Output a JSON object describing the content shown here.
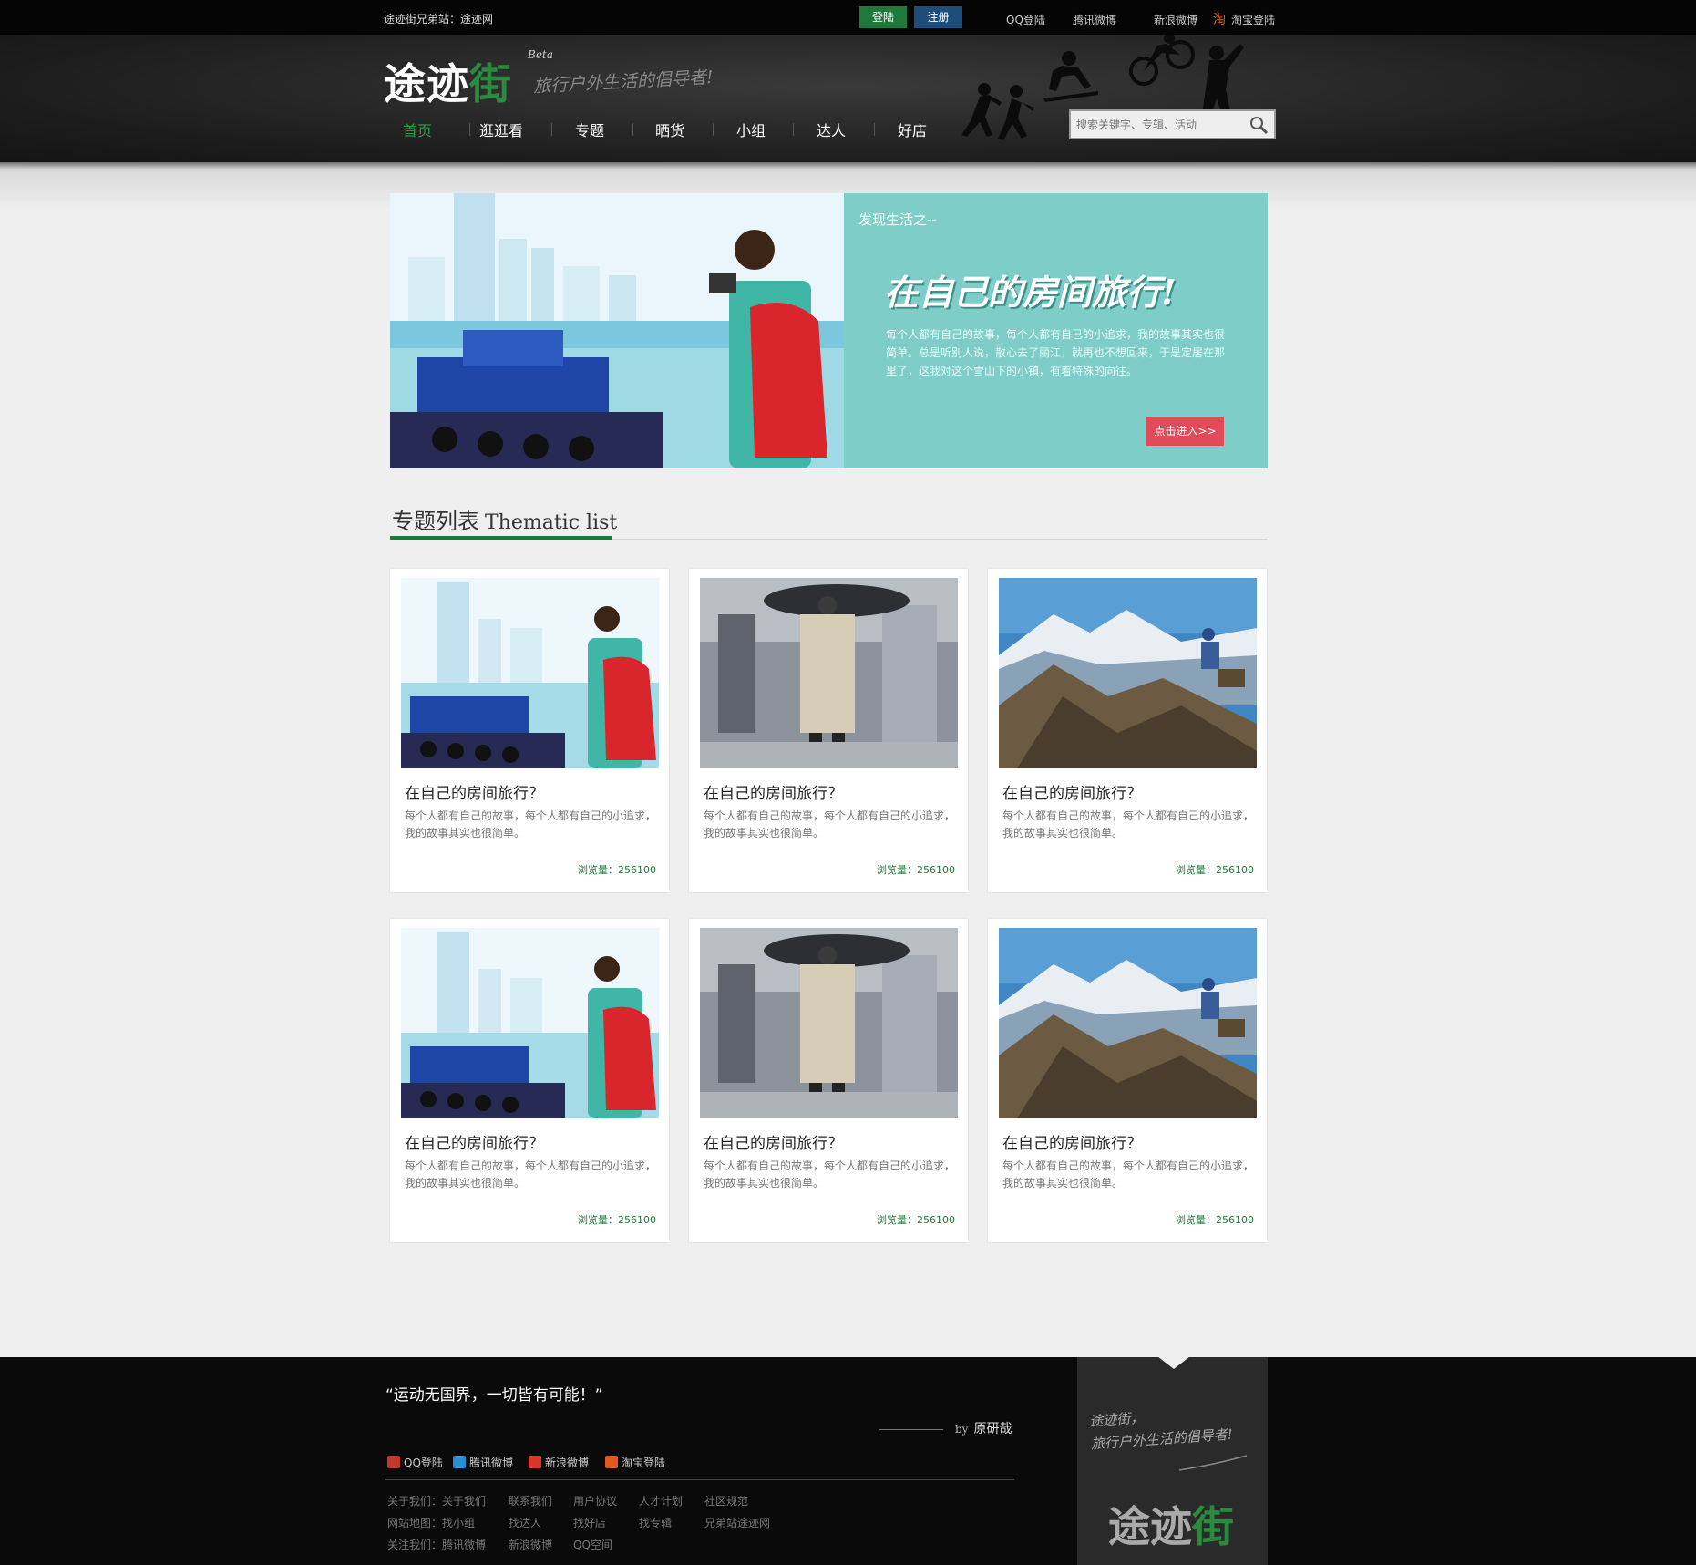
{
  "topbar": {
    "sister_site": "途迹街兄弟站：途迹网",
    "login": "登陆",
    "register": "注册",
    "links": [
      "QQ登陆",
      "腾讯微博",
      "新浪微博",
      "淘宝登陆"
    ]
  },
  "header": {
    "logo_main": "途迹",
    "logo_accent": "街",
    "beta": "Beta",
    "slogan": "旅行户外生活的倡导者!",
    "nav": [
      "首页",
      "逛逛看",
      "专题",
      "晒货",
      "小组",
      "达人",
      "好店"
    ],
    "search_placeholder": "搜索关键字、专辑、活动"
  },
  "banner": {
    "kicker": "发现生活之--",
    "headline": "在自己的房间旅行!",
    "desc": "每个人都有自己的故事，每个人都有自己的小追求，我的故事其实也很简单。总是听别人说，散心去了丽江，就再也不想回来，于是定居在那里了，这我对这个雪山下的小镇，有着特殊的向往。",
    "cta": "点击进入>>"
  },
  "section": {
    "title_cn": "专题列表",
    "title_en": "Thematic list"
  },
  "cards": [
    {
      "title": "在自己的房间旅行？",
      "desc": "每个人都有自己的故事，每个人都有自己的小追求，我的故事其实也很简单。",
      "views": "浏览量：256100",
      "image": "photographer"
    },
    {
      "title": "在自己的房间旅行？",
      "desc": "每个人都有自己的故事，每个人都有自己的小追求，我的故事其实也很简单。",
      "views": "浏览量：256100",
      "image": "street"
    },
    {
      "title": "在自己的房间旅行？",
      "desc": "每个人都有自己的故事，每个人都有自己的小追求，我的故事其实也很简单。",
      "views": "浏览量：256100",
      "image": "mountain"
    },
    {
      "title": "在自己的房间旅行？",
      "desc": "每个人都有自己的故事，每个人都有自己的小追求，我的故事其实也很简单。",
      "views": "浏览量：256100",
      "image": "photographer"
    },
    {
      "title": "在自己的房间旅行？",
      "desc": "每个人都有自己的故事，每个人都有自己的小追求，我的故事其实也很简单。",
      "views": "浏览量：256100",
      "image": "street"
    },
    {
      "title": "在自己的房间旅行？",
      "desc": "每个人都有自己的故事，每个人都有自己的小追求，我的故事其实也很简单。",
      "views": "浏览量：256100",
      "image": "mountain"
    }
  ],
  "footer": {
    "quote": "“运动无国界，一切皆有可能！”",
    "by": "by",
    "author": "原研哉",
    "social": [
      "QQ登陆",
      "腾讯微博",
      "新浪微博",
      "淘宝登陆"
    ],
    "rows": [
      [
        "关于我们：关于我们",
        "联系我们",
        "用户协议",
        "人才计划",
        "社区规范"
      ],
      [
        "网站地图：找小组",
        "找达人",
        "找好店",
        "找专辑",
        "兄弟站途迹网"
      ],
      [
        "关注我们：腾讯微博",
        "新浪微博",
        "QQ空间"
      ]
    ],
    "panel_slogan_1": "途迹街，",
    "panel_slogan_2": "旅行户外生活的倡导者!",
    "panel_logo_main": "途迹",
    "panel_logo_accent": "街"
  },
  "colors": {
    "brand_green": "#1e7a3c",
    "register_blue": "#1d4d7a",
    "banner_teal": "#7ecdc8",
    "cta_red": "#e24a58"
  }
}
